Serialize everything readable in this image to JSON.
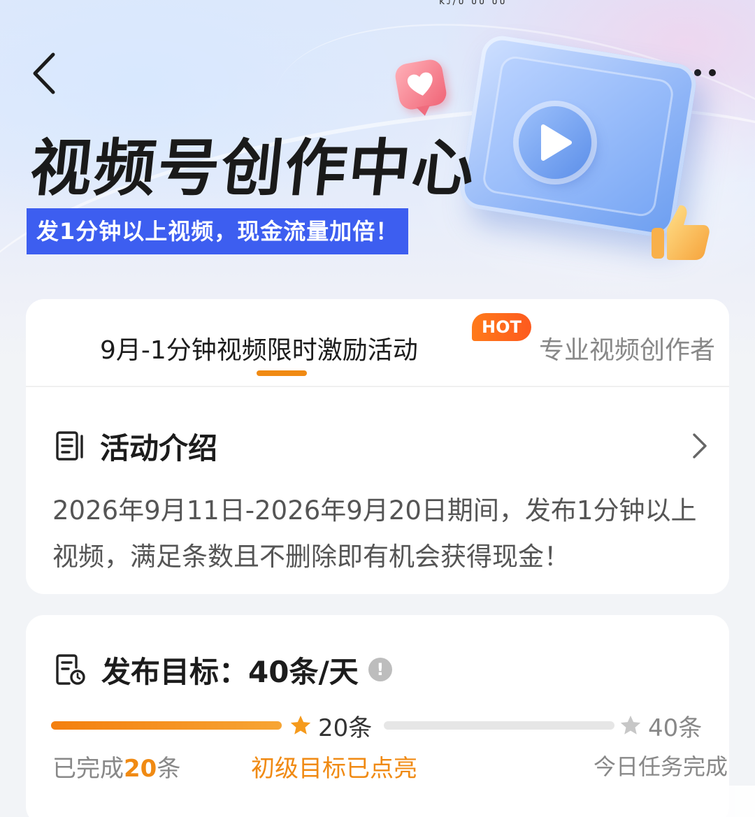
{
  "header": {
    "title": "视频号创作中心",
    "subtitle": "发1分钟以上视频，现金流量加倍！",
    "status_blip": "ᴋᴊ/ᴜ ᴜᴜ ᴜᴜ"
  },
  "tabs": [
    {
      "label": "9月-1分钟视频限时激励活动",
      "active": true,
      "badge": "HOT"
    },
    {
      "label": "专业视频创作者",
      "active": false
    }
  ],
  "intro": {
    "title": "活动介绍",
    "text": "2026年9月11日-2026年9月20日期间，发布1分钟以上视频，满足条数且不删除即有机会获得现金！"
  },
  "goal": {
    "title": "发布目标：40条/天",
    "info_icon": "!",
    "progress_fraction": 0.5,
    "milestones": [
      {
        "label": "20条",
        "reached": true
      },
      {
        "label": "40条",
        "reached": false
      }
    ],
    "completed_prefix": "已完成",
    "completed_count": "20",
    "completed_suffix": "条",
    "level_status": "初级目标已点亮",
    "today_status": "今日任务完成"
  },
  "colors": {
    "accent": "#f08a13",
    "brand_blue": "#3d5ef0",
    "hot_badge": "#fd5a1e",
    "muted_text": "#888888"
  },
  "icons": [
    "back-icon",
    "more-icon",
    "heart-icon",
    "play-icon",
    "thumbs-up-icon",
    "document-icon",
    "chevron-right-icon",
    "calendar-clock-icon",
    "info-icon",
    "star-icon"
  ]
}
